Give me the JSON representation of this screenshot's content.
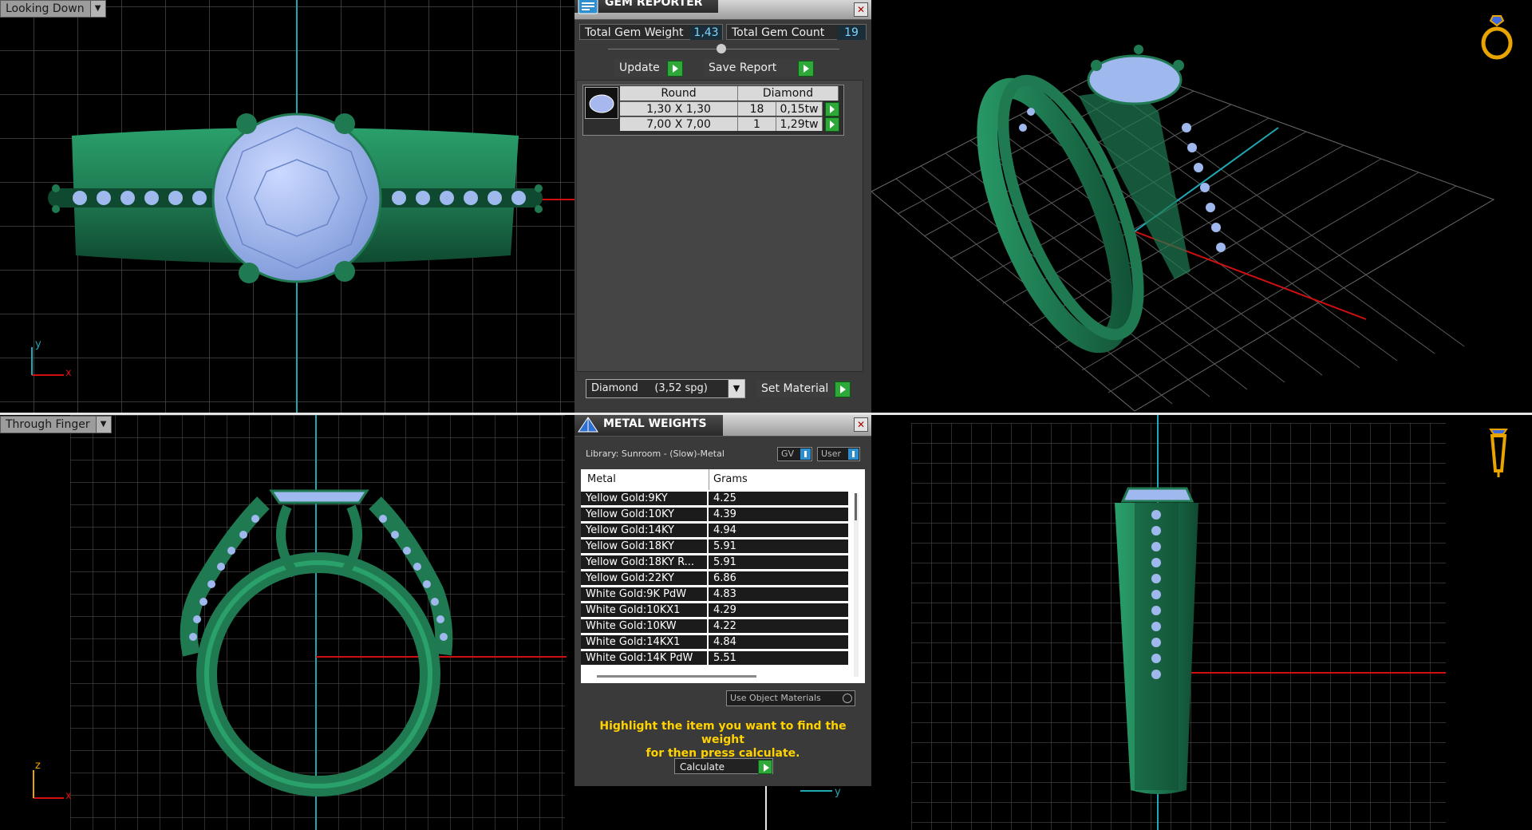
{
  "viewports": {
    "top_left": {
      "label": "Looking Down",
      "axis_v": "y",
      "axis_h": "x"
    },
    "bottom_left": {
      "label": "Through Finger",
      "axis_v": "z",
      "axis_h": "x"
    },
    "bottom_right": {
      "axis_h": "y"
    }
  },
  "gem_reporter": {
    "title": "GEM REPORTER",
    "total_weight_label": "Total Gem Weight",
    "total_weight_value": "1,43",
    "total_count_label": "Total Gem Count",
    "total_count_value": "19",
    "update_label": "Update",
    "save_report_label": "Save Report",
    "table_headers": [
      "Round",
      "Diamond"
    ],
    "rows": [
      {
        "size": "1,30 X 1,30",
        "count": "18",
        "weight": "0,15tw"
      },
      {
        "size": "7,00 X 7,00",
        "count": "1",
        "weight": "1,29tw"
      }
    ],
    "material_select": "Diamond     (3,52 spg)",
    "set_material_label": "Set Material"
  },
  "metal_weights": {
    "title": "METAL WEIGHTS",
    "library": "Library: Sunroom - (Slow)-Metal",
    "gv_label": "GV",
    "user_label": "User",
    "col_metal": "Metal",
    "col_grams": "Grams",
    "rows": [
      {
        "metal": "Yellow Gold:9KY",
        "grams": "4.25"
      },
      {
        "metal": "Yellow Gold:10KY",
        "grams": "4.39"
      },
      {
        "metal": "Yellow Gold:14KY",
        "grams": "4.94"
      },
      {
        "metal": "Yellow Gold:18KY",
        "grams": "5.91"
      },
      {
        "metal": "Yellow Gold:18KY R...",
        "grams": "5.91"
      },
      {
        "metal": "Yellow Gold:22KY",
        "grams": "6.86"
      },
      {
        "metal": "White Gold:9K PdW",
        "grams": "4.83"
      },
      {
        "metal": "White Gold:10KX1",
        "grams": "4.29"
      },
      {
        "metal": "White Gold:10KW",
        "grams": "4.22"
      },
      {
        "metal": "White Gold:14KX1",
        "grams": "4.84"
      },
      {
        "metal": "White Gold:14K PdW",
        "grams": "5.51"
      }
    ],
    "use_object_materials": "Use Object Materials",
    "note_line1": "Highlight the item you want to find the weight",
    "note_line2": "for then press calculate.",
    "calculate_label": "Calculate"
  },
  "colors": {
    "ring_green": "#1f7a52",
    "gem_blue": "#9fb8ee",
    "grid": "#4a4a4a",
    "axis_red": "#d01010",
    "axis_cyan": "#20a8b4",
    "note_yellow": "#ffd200"
  },
  "icons": {
    "gem_reporter_icon": "gem-report-icon",
    "metal_weights_icon": "gem-pyramid-icon",
    "top_right_icon": "ring-perspective-icon",
    "bottom_right_icon": "ring-side-icon"
  }
}
